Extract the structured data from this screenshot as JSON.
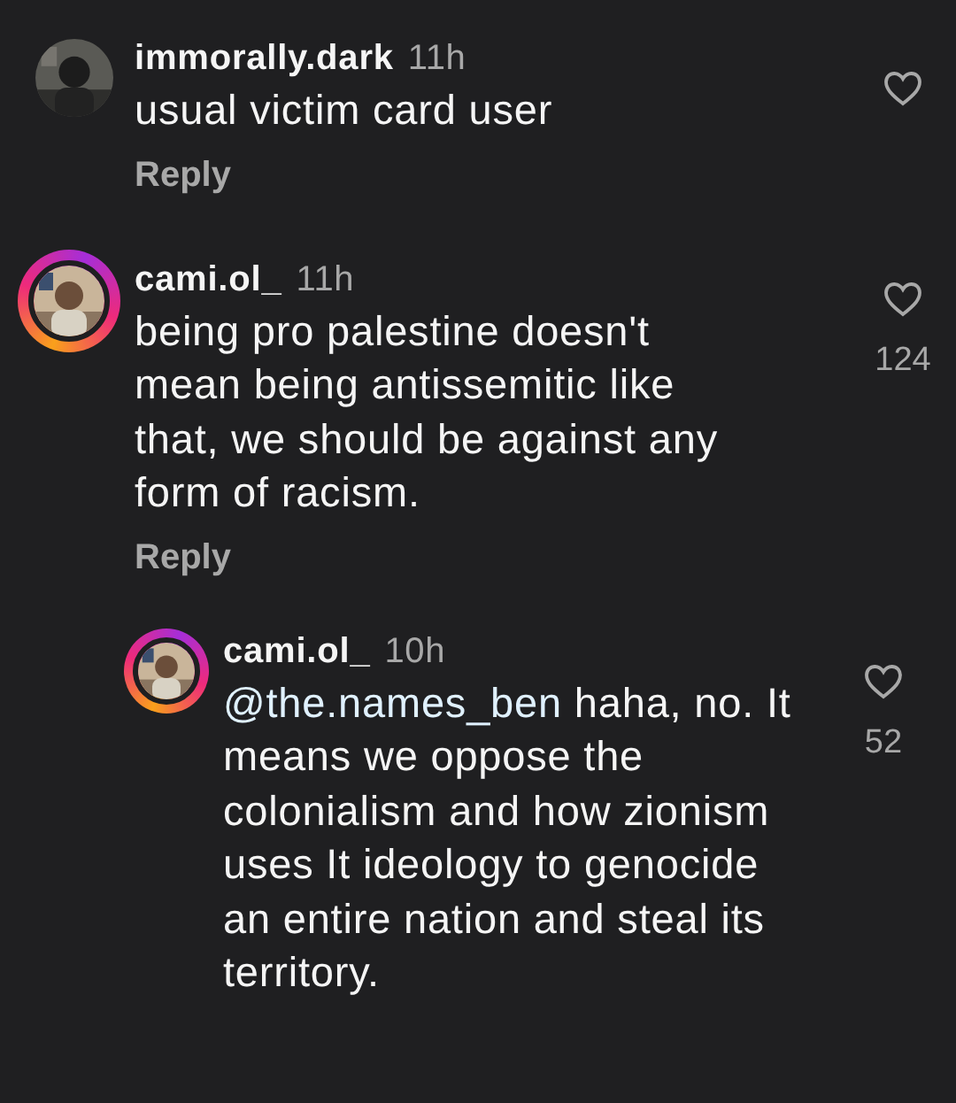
{
  "comments": [
    {
      "username": "immorally.dark",
      "time": "11h",
      "text": "usual victim card user",
      "reply": "Reply",
      "has_story": false,
      "is_reply": false,
      "liked": false
    },
    {
      "username": "cami.ol_",
      "time": "11h",
      "text": "being pro palestine doesn't mean being antissemitic like that, we should be against any form of racism.",
      "reply": "Reply",
      "has_story": true,
      "likes": "124",
      "is_reply": false,
      "liked": false
    },
    {
      "username": "cami.ol_",
      "time": "10h",
      "mention": "@the.names_ben",
      "text": "haha, no. It means we oppose the colonialism and how zionism uses It ideology to genocide an entire nation and steal its territory.",
      "has_story": true,
      "likes": "52",
      "is_reply": true,
      "liked": false
    }
  ]
}
